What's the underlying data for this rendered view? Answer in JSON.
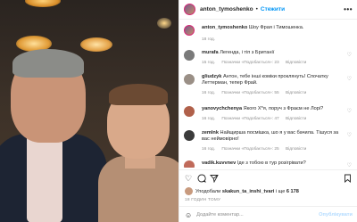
{
  "post": {
    "username": "anton_tymoshenko",
    "follow_label": "Стежити",
    "more_label": "•••"
  },
  "caption": {
    "username": "anton_tymoshenko",
    "text": "Шоу Фрая і Тимошенка.",
    "time": "18 год."
  },
  "comments": [
    {
      "username": "murafa",
      "text": "Легенда, і тіп з Британії",
      "time": "15 год.",
      "likes": "Позначки «Подобається»: 23",
      "reply": "Відповісти",
      "avatar_color": "#7a7a7a"
    },
    {
      "username": "gliudzyk",
      "text": "Антон, тебе інші коміки проклянуть! Спочатку Леттерман, тепер Фрай.",
      "time": "16 год.",
      "likes": "Позначки «Подобається»: 55",
      "reply": "Відповісти",
      "avatar_color": "#9a8f86"
    },
    {
      "username": "yanovychchenya",
      "text": "Якого Х*я, поруч з Фраєм не Лорі?",
      "time": "16 год.",
      "likes": "Позначки «Подобається»: 47",
      "reply": "Відповісти",
      "avatar_color": "#b0604a"
    },
    {
      "username": "zemlnk",
      "text": "Найщирша посмішка, шо я у вас бачила. Тішуся за вас неймовірно!",
      "time": "16 год.",
      "likes": "Позначки «Подобається»: 25",
      "reply": "Відповісти",
      "avatar_color": "#3b3b3b"
    },
    {
      "username": "vadik.kuvvnev",
      "text": "Іде з тобою в тур розігрівати?",
      "time": "",
      "likes": "",
      "reply": "",
      "avatar_color": "#c06a5a"
    }
  ],
  "likes_line": {
    "prefix": "Уподобали",
    "user": "skakun_ta_inshi_tvari",
    "middle": "і ще",
    "count": "6 178"
  },
  "date": "18 ГОДИН ТОМУ",
  "comment_input": {
    "placeholder": "Додайте коментар...",
    "post_label": "Опублікувати"
  },
  "icons": {
    "heart": "heart-icon",
    "comment": "comment-icon",
    "share": "share-icon",
    "save": "bookmark-icon",
    "emoji": "emoji-icon"
  }
}
